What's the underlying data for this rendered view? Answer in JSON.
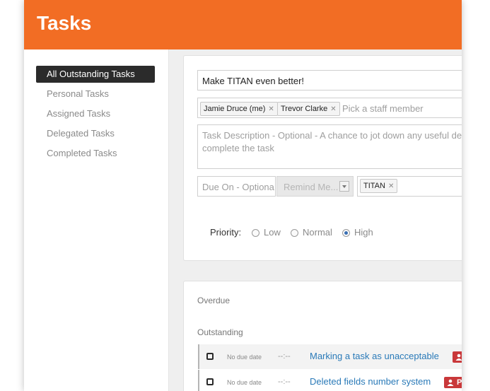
{
  "header": {
    "title": "Tasks"
  },
  "sidebar": {
    "items": [
      {
        "label": "All Outstanding Tasks",
        "active": true
      },
      {
        "label": "Personal Tasks",
        "active": false
      },
      {
        "label": "Assigned Tasks",
        "active": false
      },
      {
        "label": "Delegated Tasks",
        "active": false
      },
      {
        "label": "Completed Tasks",
        "active": false
      }
    ]
  },
  "form": {
    "title_value": "Make TITAN even better!",
    "staff": {
      "tags": [
        "Jamie Druce (me)",
        "Trevor Clarke"
      ],
      "placeholder": "Pick a staff member"
    },
    "description_placeholder": "Task Description - Optional - A chance to jot down any useful de complete the task",
    "description_line1": "Task Description - Optional - A chance to jot down any useful de",
    "description_line2": "complete the task",
    "due_placeholder": "Due On - Optiona",
    "remind_label": "Remind Me...",
    "project_tag": "TITAN",
    "priority": {
      "label": "Priority:",
      "options": [
        "Low",
        "Normal",
        "High"
      ],
      "selected": "High"
    }
  },
  "lists": {
    "overdue_label": "Overdue",
    "outstanding_label": "Outstanding",
    "tasks": [
      {
        "due": "No due date",
        "time": "--:--",
        "title": "Marking a task as unacceptable",
        "badge": ""
      },
      {
        "due": "No due date",
        "time": "--:--",
        "title": "Deleted fields number system",
        "badge": "P"
      }
    ]
  },
  "colors": {
    "brand": "#f26d24",
    "link": "#2a7ab8",
    "badge": "#c9383a",
    "nav_active": "#2b2b2b"
  },
  "icons": {
    "tag_remove": "close-icon",
    "dropdown": "chevron-down-icon",
    "assignee": "user-icon"
  }
}
